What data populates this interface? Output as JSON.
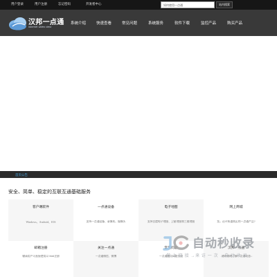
{
  "topbar": {
    "links": [
      "用户登录",
      "用户注册",
      "忘记密码",
      "开发者中心"
    ],
    "search_placeholder": "如何使用一点通",
    "search_button": "站内搜索"
  },
  "brand": {
    "name": "汉邦一点通",
    "tagline": "internet video view"
  },
  "nav": {
    "items": [
      "系统介绍",
      "快速查看",
      "常见问题",
      "系统服务",
      "软件下载",
      "监控产品",
      "购买产品"
    ]
  },
  "breadcrumb": "首页公告",
  "section": {
    "title": "安全、简单、稳定的互联互通基础服务"
  },
  "services": [
    {
      "title": "客户端软件",
      "desc": "Windows、Android、IOS"
    },
    {
      "title": "一点通设备",
      "desc": "支持一点通设备、录像机、摄像头"
    },
    {
      "title": "电子地图",
      "desc": "支持百度电子地图、卫星地图和三维地图"
    },
    {
      "title": "网上商城",
      "desc": "您，还不知道购买的一点通产品?"
    },
    {
      "title": "邮箱注册",
      "desc": "输请用户可直接使用以 Mail注册"
    },
    {
      "title": "关注一点通",
      "desc": "一点通微信、微博"
    },
    {
      "title": "常见问题",
      "desc": "一点通使用问题交流"
    },
    {
      "title": "汉邦一点通",
      "desc": "随时随地了解一点通动态"
    }
  ],
  "watermark": {
    "title": "自动秒收录",
    "subtitle": "做 上 链 接 →来 访 一 次 →自 动 收 录 →"
  },
  "colors": {
    "topbar_bg": "#161616",
    "navbar_bg": "#393939",
    "crumbbar_bg": "#2a2a2a",
    "link_blue": "#48a6e0",
    "card_gray": "#f6f6f6"
  }
}
